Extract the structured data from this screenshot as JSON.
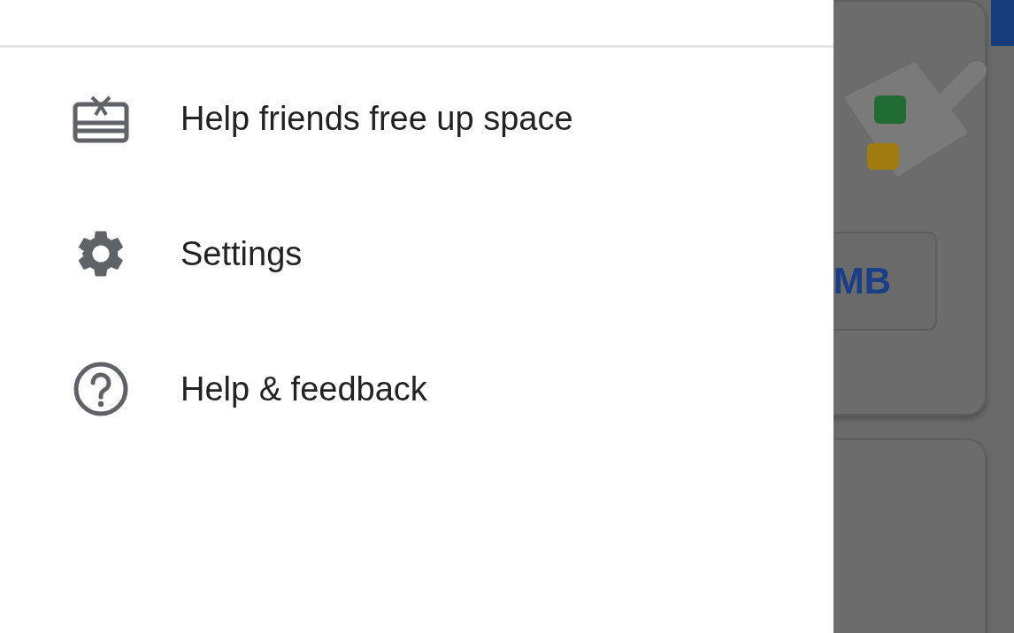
{
  "drawer": {
    "items": [
      {
        "kind": "gift",
        "label": "Help friends free up space"
      },
      {
        "kind": "settings",
        "label": "Settings"
      },
      {
        "kind": "help",
        "label": "Help & feedback"
      }
    ]
  },
  "background": {
    "size_button": "MB"
  }
}
